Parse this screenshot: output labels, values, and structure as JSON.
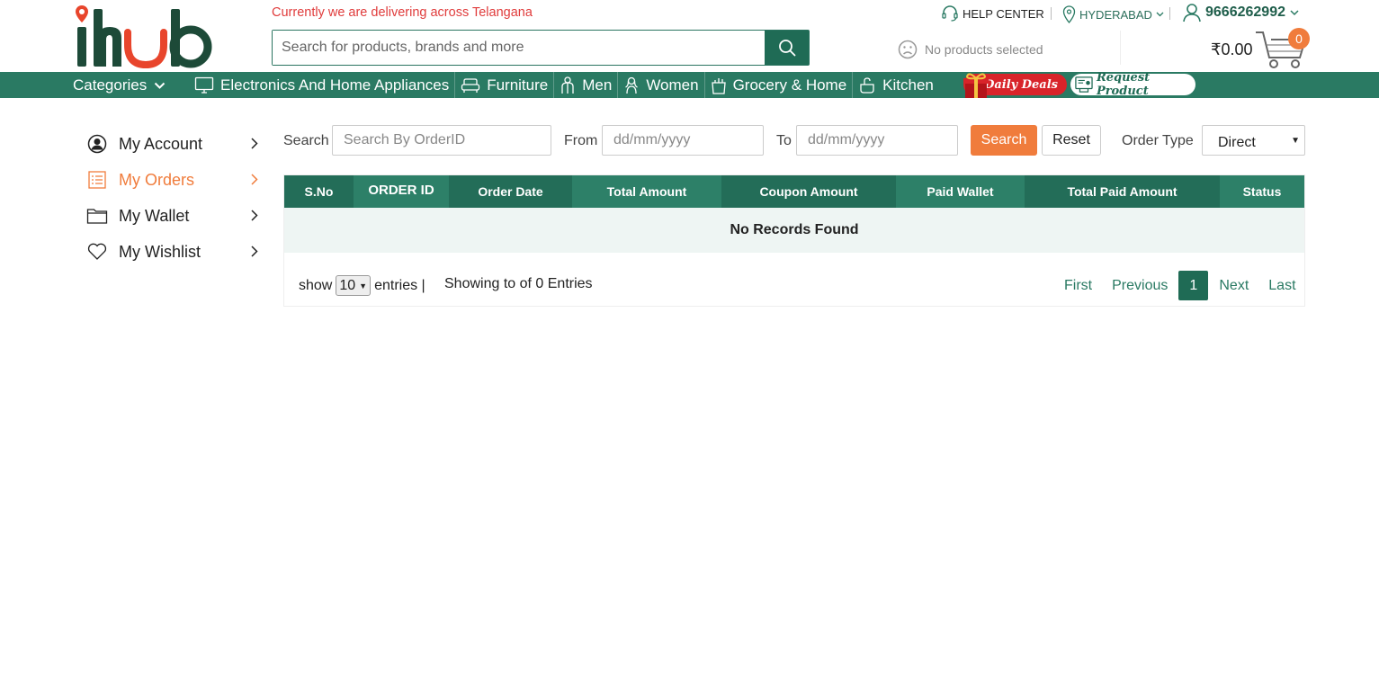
{
  "header": {
    "delivery_notice": "Currently we are delivering across Telangana",
    "search_placeholder": "Search for products, brands and more",
    "help_center": "HELP CENTER",
    "city": "HYDERABAD",
    "user_phone": "9666262992",
    "cart_status": "No products selected",
    "cart_total": "₹0.00",
    "cart_count": "0"
  },
  "nav": {
    "categories_label": "Categories",
    "items": [
      {
        "label": "Electronics And Home Appliances",
        "icon": "monitor-icon"
      },
      {
        "label": "Furniture",
        "icon": "sofa-icon"
      },
      {
        "label": "Men",
        "icon": "man-icon"
      },
      {
        "label": "Women",
        "icon": "woman-icon"
      },
      {
        "label": "Grocery & Home",
        "icon": "grocery-bag-icon"
      },
      {
        "label": "Kitchen",
        "icon": "kitchen-icon"
      }
    ],
    "daily_deals": "Daily Deals",
    "request_product": "Request Product"
  },
  "sidebar": {
    "items": [
      {
        "label": "My Account",
        "icon": "user-circle-icon"
      },
      {
        "label": "My Orders",
        "icon": "list-icon",
        "active": true
      },
      {
        "label": "My Wallet",
        "icon": "folder-icon"
      },
      {
        "label": "My Wishlist",
        "icon": "heart-icon"
      }
    ]
  },
  "filters": {
    "search_label": "Search",
    "search_placeholder": "Search By OrderID",
    "from_label": "From",
    "from_placeholder": "dd/mm/yyyy",
    "to_label": "To",
    "to_placeholder": "dd/mm/yyyy",
    "search_button": "Search",
    "reset_button": "Reset",
    "order_type_label": "Order Type",
    "order_type_value": "Direct"
  },
  "table": {
    "columns": [
      "S.No",
      "ORDER ID",
      "Order Date",
      "Total Amount",
      "Coupon Amount",
      "Paid Wallet",
      "Total Paid Amount",
      "Status"
    ],
    "empty_message": "No Records Found"
  },
  "pagination": {
    "show_label": "show",
    "page_size": "10",
    "entries_label": "entries |",
    "showing_text": "Showing to of 0 Entries",
    "first": "First",
    "previous": "Previous",
    "current": "1",
    "next": "Next",
    "last": "Last"
  },
  "colors": {
    "brand_green": "#2a7a63",
    "accent_orange": "#f07c3c",
    "notice_red": "#e03c3c"
  }
}
